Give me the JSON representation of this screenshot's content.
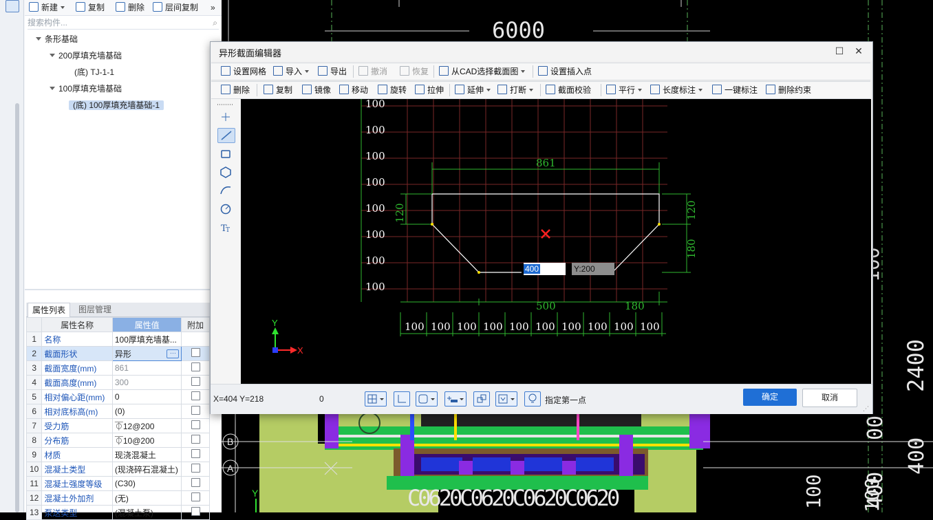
{
  "component_toolbar": {
    "new": "新建",
    "copy": "复制",
    "delete": "删除",
    "floor_copy": "层间复制",
    "more": "»"
  },
  "search": {
    "placeholder": "搜索构件..."
  },
  "tree": {
    "root": "条形基础",
    "group1": "200厚填充墙基础",
    "group1_item": "(底) TJ-1-1",
    "group2": "100厚填充墙基础",
    "group2_item": "(底) 100厚填充墙基础-1"
  },
  "props": {
    "tab_active": "属性列表",
    "tab_inactive": "图层管理",
    "col_name": "属性名称",
    "col_value": "属性值",
    "col_extra": "附加",
    "rows": [
      {
        "n": "1",
        "name": "名称",
        "value": "100厚填充墙基..."
      },
      {
        "n": "2",
        "name": "截面形状",
        "value": "异形"
      },
      {
        "n": "3",
        "name": "截面宽度(mm)",
        "value": "861"
      },
      {
        "n": "4",
        "name": "截面高度(mm)",
        "value": "300"
      },
      {
        "n": "5",
        "name": "相对偏心距(mm)",
        "value": "0"
      },
      {
        "n": "6",
        "name": "相对底标高(m)",
        "value": "(0)"
      },
      {
        "n": "7",
        "name": "受力筋",
        "value": "⏁12@200"
      },
      {
        "n": "8",
        "name": "分布筋",
        "value": "⏁10@200"
      },
      {
        "n": "9",
        "name": "材质",
        "value": "现浇混凝土"
      },
      {
        "n": "10",
        "name": "混凝土类型",
        "value": "(现浇碎石混凝土)"
      },
      {
        "n": "11",
        "name": "混凝土强度等级",
        "value": "(C30)"
      },
      {
        "n": "12",
        "name": "混凝土外加剂",
        "value": "(无)"
      },
      {
        "n": "13",
        "name": "泵送类型",
        "value": "(混凝土泵)"
      }
    ]
  },
  "background_cad": {
    "top_dim": "6000",
    "axis_b": "B",
    "axis_a": "A",
    "axis_y": "Y",
    "right_dims": [
      "2400",
      "100",
      "400",
      "400",
      "00",
      "100",
      "100"
    ],
    "bottom_text": "C0620C0620C0620C0620"
  },
  "dialog": {
    "title": "异形截面编辑器",
    "toolbar1": {
      "grid": "设置网格",
      "import": "导入",
      "export": "导出",
      "undo": "撤消",
      "redo": "恢复",
      "from_cad": "从CAD选择截面图",
      "insert_point": "设置插入点"
    },
    "toolbar2": {
      "delete": "删除",
      "copy": "复制",
      "mirror": "镜像",
      "move": "移动",
      "rotate": "旋转",
      "stretch": "拉伸",
      "extend": "延伸",
      "break": "打断",
      "check": "截面校验",
      "parallel": "平行",
      "length_dim": "长度标注",
      "auto_dim": "一键标注",
      "del_constraint": "删除约束"
    },
    "canvas": {
      "grid_y_labels": [
        "100",
        "100",
        "100",
        "100",
        "100",
        "100",
        "100",
        "100"
      ],
      "grid_x_labels": [
        "100",
        "100",
        "100",
        "100",
        "100",
        "100",
        "100",
        "100",
        "100",
        "100"
      ],
      "dim_top": "861",
      "dim_left": "120",
      "dim_right_top": "120",
      "dim_right_bottom": "180",
      "dim_bottom_mid": "500",
      "dim_bottom_right": "180",
      "input_x": "400",
      "input_y": "Y:200",
      "axis_y": "Y",
      "axis_x": "X"
    },
    "status": {
      "coords": "X=404 Y=218",
      "value": "0",
      "hint": "指定第一点"
    },
    "buttons": {
      "ok": "确定",
      "cancel": "取消"
    }
  }
}
